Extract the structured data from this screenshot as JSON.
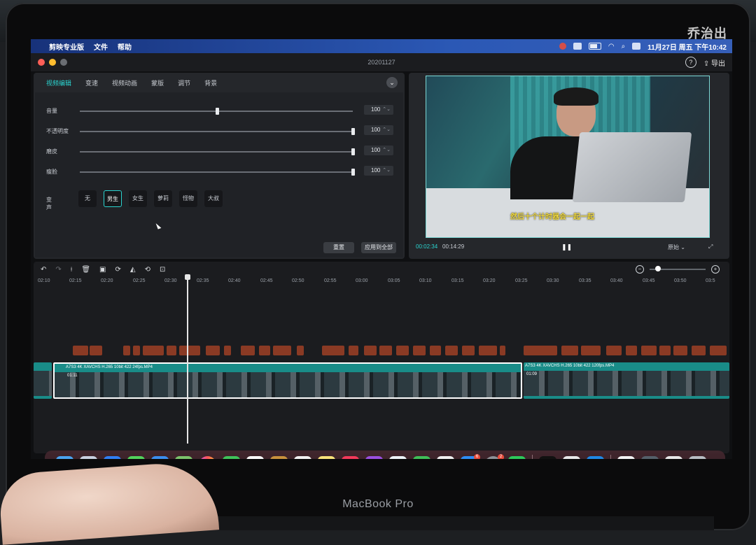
{
  "menubar": {
    "items": [
      "剪映专业版",
      "文件",
      "帮助"
    ],
    "clock": "11月27日 周五 下午10:42"
  },
  "window": {
    "title": "20201127",
    "help_glyph": "?",
    "export_label": "导出"
  },
  "editor": {
    "tabs": [
      "视频编辑",
      "变速",
      "视频动画",
      "蒙版",
      "调节",
      "背景"
    ],
    "active_tab": "视频编辑",
    "properties": [
      {
        "label": "音量",
        "value": "100",
        "level": 0.5
      },
      {
        "label": "不透明度",
        "value": "100",
        "level": 1.0
      },
      {
        "label": "磨皮",
        "value": "100",
        "level": 1.0
      },
      {
        "label": "瘦脸",
        "value": "100",
        "level": 1.0
      }
    ],
    "voice_label": "变声",
    "voice_options": [
      "无",
      "男生",
      "女生",
      "萝莉",
      "怪物",
      "大叔"
    ],
    "voice_selected": "男生",
    "reset_button": "重置",
    "apply_all_button": "应用到全部"
  },
  "preview": {
    "subtitle": "然后十个计时器会一起一起",
    "current_time": "00:02:34",
    "total_time": "00:14:29",
    "ratio": "原始"
  },
  "timeline": {
    "ruler": [
      "02:10",
      "02:15",
      "02:20",
      "02:25",
      "02:30",
      "02:35",
      "02:40",
      "02:45",
      "02:50",
      "02:55",
      "03:00",
      "03:05",
      "03:10",
      "03:15",
      "03:20",
      "03:25",
      "03:30",
      "03:35",
      "03:40",
      "03:45",
      "03:50",
      "03:5"
    ],
    "clip1_label": "A7S3 4K XAVCHS H.265 10bit 422 24fps.MP4",
    "clip1_time": "01:11",
    "clip2_label": "A7S3 4K XAVCHS H.265 10bit 422 120fps.MP4",
    "clip2_time": "01:09",
    "zoom_level": 0.1
  },
  "watermark": "乔治出",
  "device": {
    "brand": "MacBook Pro"
  },
  "dock": {
    "calendar_day": "27",
    "appstore_badge": "6",
    "settings_badge": "2"
  },
  "colors": {
    "accent": "#2bd4d0",
    "clip": "#198c88",
    "subtitle_clip": "#8a3a24",
    "menubar": "#2b58b5"
  }
}
